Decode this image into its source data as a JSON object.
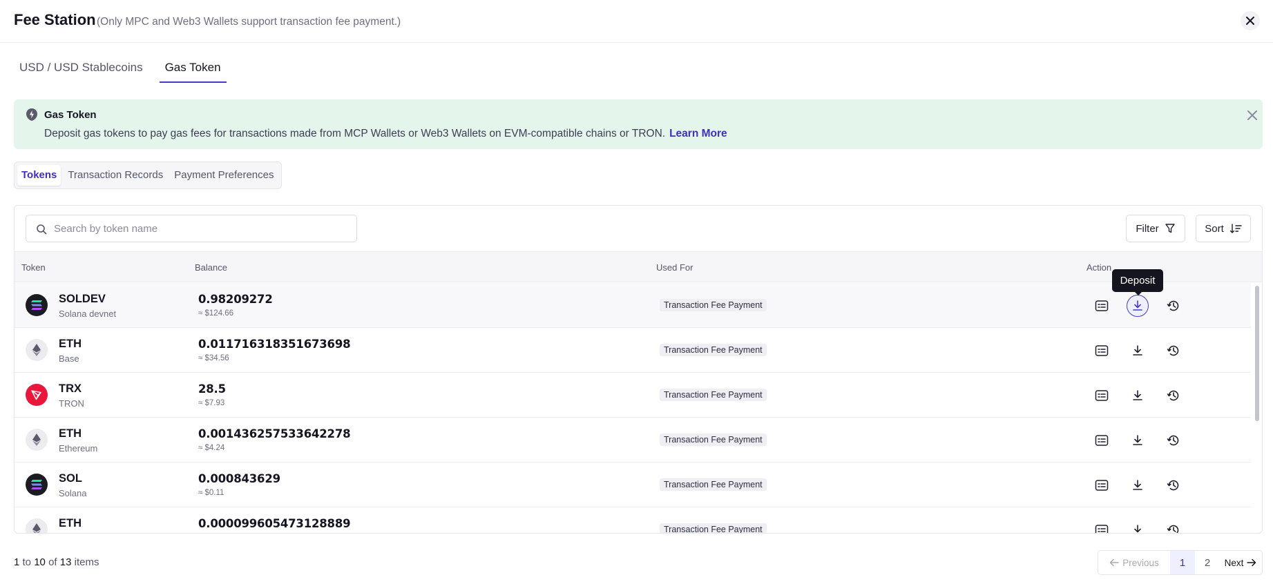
{
  "header": {
    "title": "Fee Station",
    "subtitle": "(Only MPC and Web3 Wallets support transaction fee payment.)"
  },
  "main_tabs": [
    {
      "label": "USD / USD Stablecoins",
      "active": false
    },
    {
      "label": "Gas Token",
      "active": true
    }
  ],
  "banner": {
    "title": "Gas Token",
    "text": "Deposit gas tokens to pay gas fees for transactions made from MCP Wallets or Web3 Wallets on EVM-compatible chains or TRON.",
    "link": "Learn More",
    "color": "#e4f5ec"
  },
  "sub_tabs": [
    {
      "label": "Tokens",
      "active": true
    },
    {
      "label": "Transaction Records",
      "active": false
    },
    {
      "label": "Payment Preferences",
      "active": false
    }
  ],
  "toolbar": {
    "search_placeholder": "Search by token name",
    "filter_label": "Filter",
    "sort_label": "Sort"
  },
  "table": {
    "columns": [
      "Token",
      "Balance",
      "Used For",
      "Action"
    ],
    "rows": [
      {
        "symbol": "SOLDEV",
        "network": "Solana devnet",
        "balance": "0.98209272",
        "usd": "≈ $124.66",
        "used_for": "Transaction Fee Payment",
        "icon": "solana-icon"
      },
      {
        "symbol": "ETH",
        "network": "Base",
        "balance": "0.011716318351673698",
        "usd": "≈ $34.56",
        "used_for": "Transaction Fee Payment",
        "icon": "ethereum-icon"
      },
      {
        "symbol": "TRX",
        "network": "TRON",
        "balance": "28.5",
        "usd": "≈ $7.93",
        "used_for": "Transaction Fee Payment",
        "icon": "tron-icon"
      },
      {
        "symbol": "ETH",
        "network": "Ethereum",
        "balance": "0.001436257533642278",
        "usd": "≈ $4.24",
        "used_for": "Transaction Fee Payment",
        "icon": "ethereum-icon"
      },
      {
        "symbol": "SOL",
        "network": "Solana",
        "balance": "0.000843629",
        "usd": "≈ $0.11",
        "used_for": "Transaction Fee Payment",
        "icon": "solana-icon"
      },
      {
        "symbol": "ETH",
        "network": "",
        "balance": "0.000099605473128889",
        "usd": "",
        "used_for": "Transaction Fee Payment",
        "icon": "ethereum-icon"
      }
    ]
  },
  "tooltip": "Deposit",
  "footer": {
    "from": "1",
    "to": "10",
    "total": "13",
    "to_word": "to",
    "of_word": "of",
    "items_word": "items"
  },
  "pagination": {
    "previous": "Previous",
    "pages": [
      "1",
      "2"
    ],
    "current": "1",
    "next": "Next"
  },
  "colors": {
    "accent": "#3f3bc6",
    "link": "#3f2fc0",
    "tron": "#e8173b",
    "solana_bg": "#1b1b22"
  }
}
